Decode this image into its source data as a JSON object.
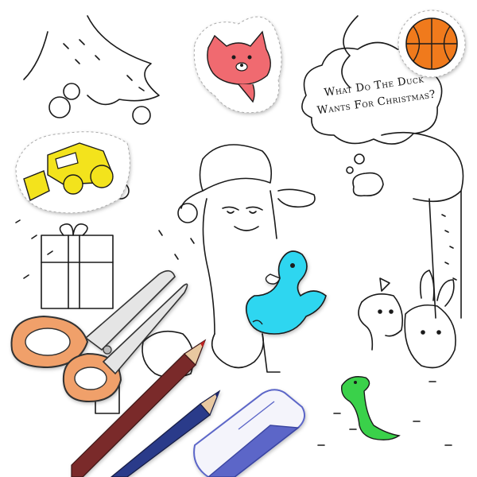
{
  "scene": {
    "speech_bubble": {
      "line1": "What Do The Duck",
      "line2": "Wants For Christmas?"
    }
  },
  "colors": {
    "background": "#ffffff",
    "ink": "#1a1a1a",
    "bear_sticker": "#f06a6f",
    "basketball": "#f07a1e",
    "bulldozer": "#f3e31b",
    "duck": "#2fd6f0",
    "crocodile": "#3ad14a",
    "scissors_handle": "#f0a06a",
    "red_pencil": "#7a2a2a",
    "blue_pencil": "#2b3a8a",
    "eraser": "#5b66c8"
  },
  "stickers": [
    "bear-sticker",
    "basketball-sticker",
    "bulldozer-sticker"
  ],
  "tools": [
    "scissors-tool",
    "red-pencil-tool",
    "blue-pencil-tool",
    "eraser-tool"
  ]
}
